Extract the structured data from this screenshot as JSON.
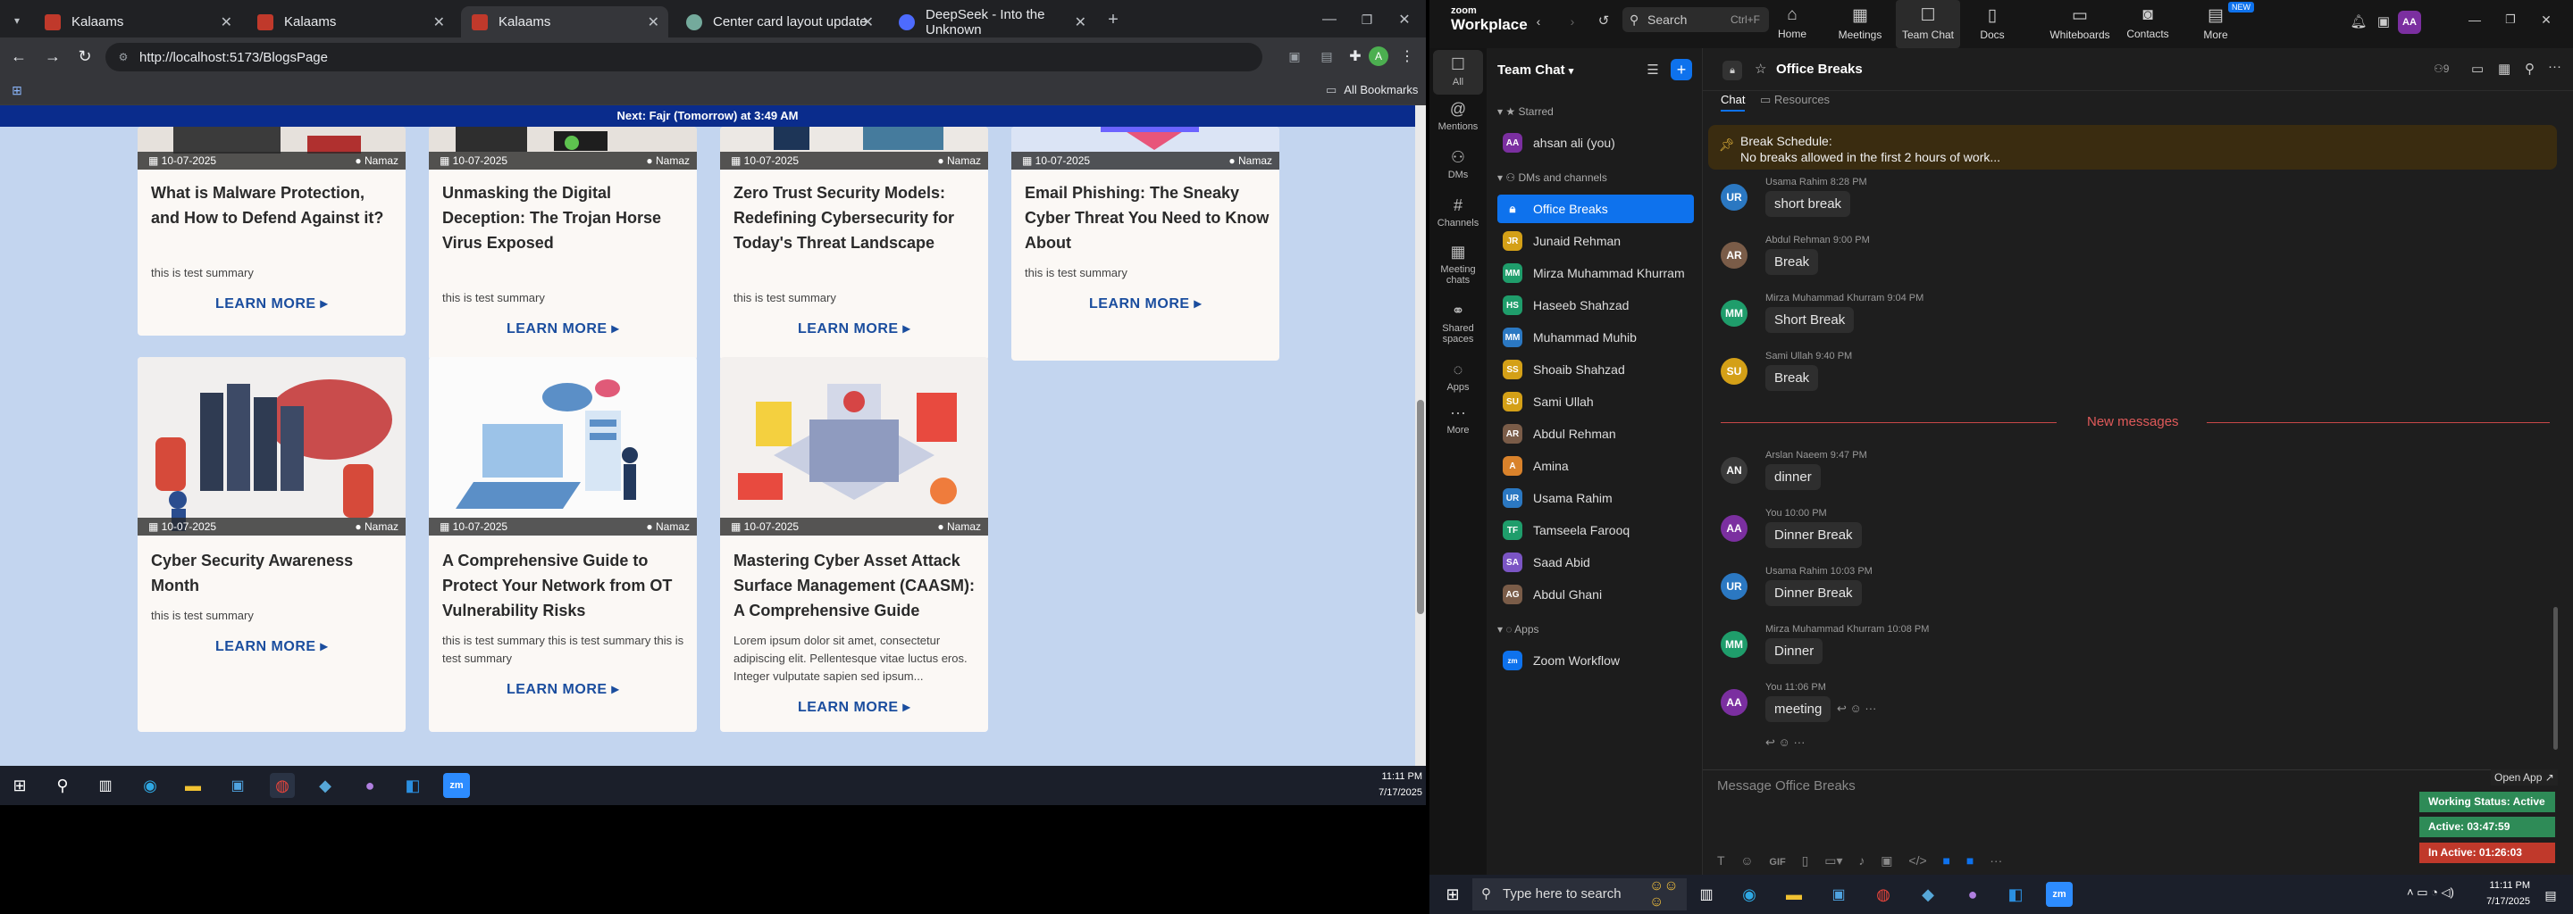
{
  "browser": {
    "tabs": [
      {
        "title": "Kalaams",
        "fav": "#c0392b"
      },
      {
        "title": "Kalaams",
        "fav": "#c0392b"
      },
      {
        "title": "Kalaams",
        "fav": "#c0392b"
      },
      {
        "title": "Center card layout update",
        "fav": "#74aa9c"
      },
      {
        "title": "DeepSeek - Into the Unknown",
        "fav": "#4d6bfe"
      }
    ],
    "url": "http://localhost:5173/BlogsPage",
    "all_bookmarks": "All Bookmarks",
    "avatar_letter": "A"
  },
  "page": {
    "prayer_banner": "Next: Fajr (Tomorrow) at 3:49 AM",
    "cards": [
      {
        "date": "10-07-2025",
        "author": "Namaz",
        "title": "What is Malware Protection, and How to Defend Against it?",
        "summary": "this is test summary",
        "cta": "LEARN MORE ▸"
      },
      {
        "date": "10-07-2025",
        "author": "Namaz",
        "title": "Unmasking the Digital Deception: The Trojan Horse Virus Exposed",
        "summary": "this is test summary",
        "cta": "LEARN MORE ▸"
      },
      {
        "date": "10-07-2025",
        "author": "Namaz",
        "title": "Zero Trust Security Models: Redefining Cybersecurity for Today's Threat Landscape",
        "summary": "this is test summary",
        "cta": "LEARN MORE ▸"
      },
      {
        "date": "10-07-2025",
        "author": "Namaz",
        "title": "Email Phishing: The Sneaky Cyber Threat You Need to Know About",
        "summary": "this is test summary",
        "cta": "LEARN MORE ▸"
      },
      {
        "date": "10-07-2025",
        "author": "Namaz",
        "title": "Cyber Security Awareness Month",
        "summary": "this is test summary",
        "cta": "LEARN MORE ▸"
      },
      {
        "date": "10-07-2025",
        "author": "Namaz",
        "title": "A Comprehensive Guide to Protect Your Network from OT Vulnerability Risks",
        "summary": "this is test summary this is test summary this is test summary",
        "cta": "LEARN MORE ▸"
      },
      {
        "date": "10-07-2025",
        "author": "Namaz",
        "title": "Mastering Cyber Asset Attack Surface Management (CAASM): A Comprehensive Guide",
        "summary": "Lorem ipsum dolor sit amet, consectetur adipiscing elit. Pellentesque vitae luctus eros. Integer vulputate sapien sed ipsum...",
        "cta": "LEARN MORE ▸"
      }
    ]
  },
  "taskbar_left": {
    "time": "11:11 PM",
    "date": "7/17/2025"
  },
  "zoom": {
    "brand_top": "zoom",
    "brand": "Workplace",
    "search": "Search",
    "search_shortcut": "Ctrl+F",
    "nav": [
      "Home",
      "Meetings",
      "Team Chat",
      "Docs",
      "Whiteboards",
      "Contacts",
      "More"
    ],
    "new_badge": "NEW",
    "user_initials": "AA",
    "rail": [
      "All",
      "Mentions",
      "DMs",
      "Channels",
      "Meeting chats",
      "Shared spaces",
      "Apps",
      "More"
    ],
    "panel_title": "Team Chat",
    "sections": {
      "starred": "Starred",
      "dms": "DMs and channels",
      "apps": "Apps"
    },
    "starred_user": {
      "initials": "AA",
      "name": "ahsan ali (you)"
    },
    "channels": [
      {
        "initials": "",
        "name": "Office Breaks",
        "color": "#0e72ed"
      },
      {
        "initials": "JR",
        "name": "Junaid Rehman",
        "color": "#d4a017"
      },
      {
        "initials": "MM",
        "name": "Mirza Muhammad Khurram",
        "color": "#1f9d6b"
      },
      {
        "initials": "HS",
        "name": "Haseeb Shahzad",
        "color": "#1f9d6b"
      },
      {
        "initials": "MM",
        "name": "Muhammad Muhib",
        "color": "#2b78c2"
      },
      {
        "initials": "SS",
        "name": "Shoaib Shahzad",
        "color": "#d4a017"
      },
      {
        "initials": "SU",
        "name": "Sami Ullah",
        "color": "#d4a017"
      },
      {
        "initials": "AR",
        "name": "Abdul Rehman",
        "color": "#7a5c48"
      },
      {
        "initials": "A",
        "name": "Amina",
        "color": "#d9822b"
      },
      {
        "initials": "UR",
        "name": "Usama Rahim",
        "color": "#2b78c2"
      },
      {
        "initials": "TF",
        "name": "Tamseela Farooq",
        "color": "#1f9d6b"
      },
      {
        "initials": "SA",
        "name": "Saad Abid",
        "color": "#7b55c4"
      },
      {
        "initials": "AG",
        "name": "Abdul Ghani",
        "color": "#7a5c48"
      }
    ],
    "app_item": "Zoom Workflow",
    "chat_title": "Office Breaks",
    "chat_tabs": [
      "Chat",
      "Resources"
    ],
    "pinned_title": "Break Schedule:",
    "pinned_body": "No breaks allowed in the first 2 hours of work...",
    "new_messages": "New messages",
    "messages": [
      {
        "initials": "UR",
        "name": "Usama Rahim",
        "time": "8:28 PM",
        "text": "short break",
        "color": "#2b78c2"
      },
      {
        "initials": "AR",
        "name": "Abdul Rehman",
        "time": "9:00 PM",
        "text": "Break",
        "color": "#7a5c48"
      },
      {
        "initials": "MM",
        "name": "Mirza Muhammad Khurram",
        "time": "9:04 PM",
        "text": "Short Break",
        "color": "#1f9d6b"
      },
      {
        "initials": "SU",
        "name": "Sami Ullah",
        "time": "9:40 PM",
        "text": "Break",
        "color": "#d4a017"
      },
      {
        "initials": "AN",
        "name": "Arslan Naeem",
        "time": "9:47 PM",
        "text": "dinner",
        "color": "#3a3a3a"
      },
      {
        "initials": "AA",
        "name": "You",
        "time": "10:00 PM",
        "text": "Dinner Break",
        "color": "#7b2fa0"
      },
      {
        "initials": "UR",
        "name": "Usama Rahim",
        "time": "10:03 PM",
        "text": "Dinner Break",
        "color": "#2b78c2"
      },
      {
        "initials": "MM",
        "name": "Mirza Muhammad Khurram",
        "time": "10:08 PM",
        "text": "Dinner",
        "color": "#1f9d6b"
      },
      {
        "initials": "AA",
        "name": "You",
        "time": "11:06 PM",
        "text": "meeting",
        "color": "#7b2fa0"
      }
    ],
    "composer_placeholder": "Message Office Breaks",
    "open_app": "Open App ↗",
    "status": [
      {
        "text": "Working Status: Active",
        "color": "#2e8b57"
      },
      {
        "text": "Active: 03:47:59",
        "color": "#2e8b57"
      },
      {
        "text": "In Active: 01:26:03",
        "color": "#c0392b"
      }
    ]
  },
  "taskbar_right": {
    "search_placeholder": "Type here to search",
    "time": "11:11 PM",
    "date": "7/17/2025"
  }
}
